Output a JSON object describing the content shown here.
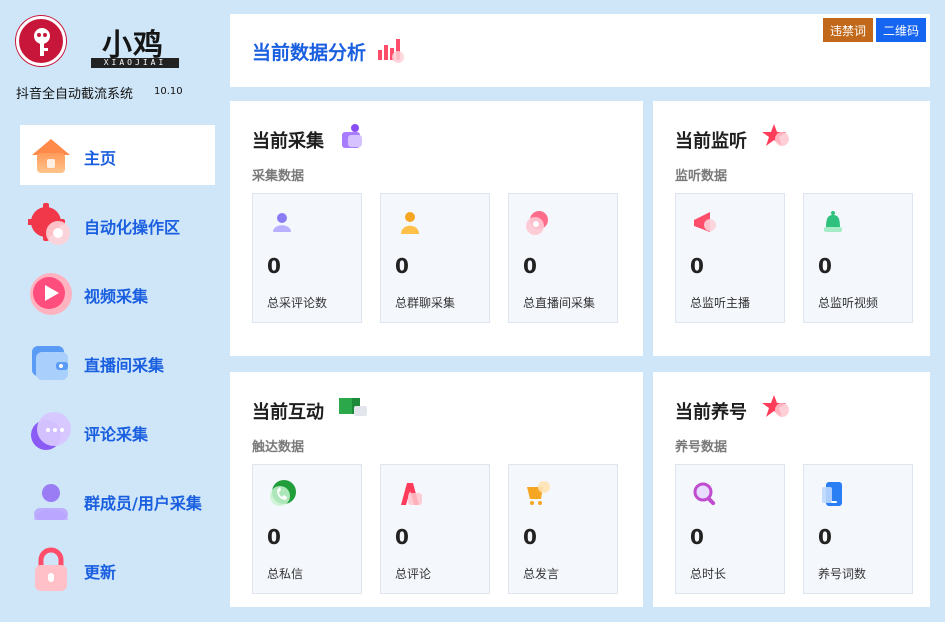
{
  "brand": {
    "name": "小鸡",
    "sub": "XIAOJIAI",
    "app_title": "抖音全自动截流系统",
    "version": "10.10"
  },
  "nav": [
    {
      "id": "home",
      "label": "主页",
      "active": true
    },
    {
      "id": "automation",
      "label": "自动化操作区"
    },
    {
      "id": "video",
      "label": "视频采集"
    },
    {
      "id": "live",
      "label": "直播间采集"
    },
    {
      "id": "comment",
      "label": "评论采集"
    },
    {
      "id": "group",
      "label": "群成员/用户采集"
    },
    {
      "id": "update",
      "label": "更新"
    }
  ],
  "header": {
    "title": "当前数据分析",
    "banned_words_label": "违禁词",
    "qr_label": "二维码"
  },
  "sections": {
    "collect": {
      "title": "当前采集",
      "subtitle": "采集数据",
      "stats": [
        {
          "label": "总采评论数",
          "value": "0"
        },
        {
          "label": "总群聊采集",
          "value": "0"
        },
        {
          "label": "总直播间采集",
          "value": "0"
        }
      ]
    },
    "monitor": {
      "title": "当前监听",
      "subtitle": "监听数据",
      "stats": [
        {
          "label": "总监听主播",
          "value": "0"
        },
        {
          "label": "总监听视频",
          "value": "0"
        }
      ]
    },
    "interact": {
      "title": "当前互动",
      "subtitle": "触达数据",
      "stats": [
        {
          "label": "总私信",
          "value": "0"
        },
        {
          "label": "总评论",
          "value": "0"
        },
        {
          "label": "总发言",
          "value": "0"
        }
      ]
    },
    "nurture": {
      "title": "当前养号",
      "subtitle": "养号数据",
      "stats": [
        {
          "label": "总时长",
          "value": "0"
        },
        {
          "label": "养号词数",
          "value": "0"
        }
      ]
    }
  },
  "colors": {
    "background": "#cfe6f8",
    "accent": "#1a5fe0",
    "banned_btn": "#c2681a",
    "qr_btn": "#1565f0"
  }
}
